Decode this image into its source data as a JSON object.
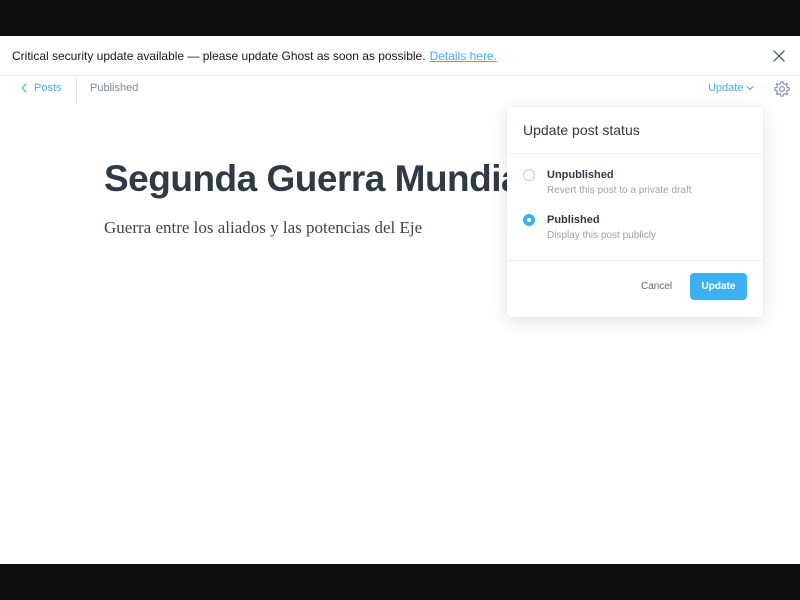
{
  "alert": {
    "message": "Critical security update available — please update Ghost as soon as possible.",
    "link_text": "Details here."
  },
  "topbar": {
    "back_label": "Posts",
    "status": "Published",
    "update_label": "Update"
  },
  "post": {
    "title": "Segunda Guerra Mundial",
    "excerpt": "Guerra entre los aliados y las potencias del Eje"
  },
  "popover": {
    "title": "Update post status",
    "options": [
      {
        "label": "Unpublished",
        "description": "Revert this post to a private draft",
        "selected": false
      },
      {
        "label": "Published",
        "description": "Display this post publicly",
        "selected": true
      }
    ],
    "cancel_label": "Cancel",
    "update_label": "Update"
  },
  "colors": {
    "accent": "#3eb0ef",
    "text": "#2f3a45",
    "muted": "#9aa5ae"
  },
  "icons": {
    "close": "close-icon",
    "back": "chevron-left-icon",
    "dropdown": "chevron-down-icon",
    "settings": "gear-icon"
  }
}
